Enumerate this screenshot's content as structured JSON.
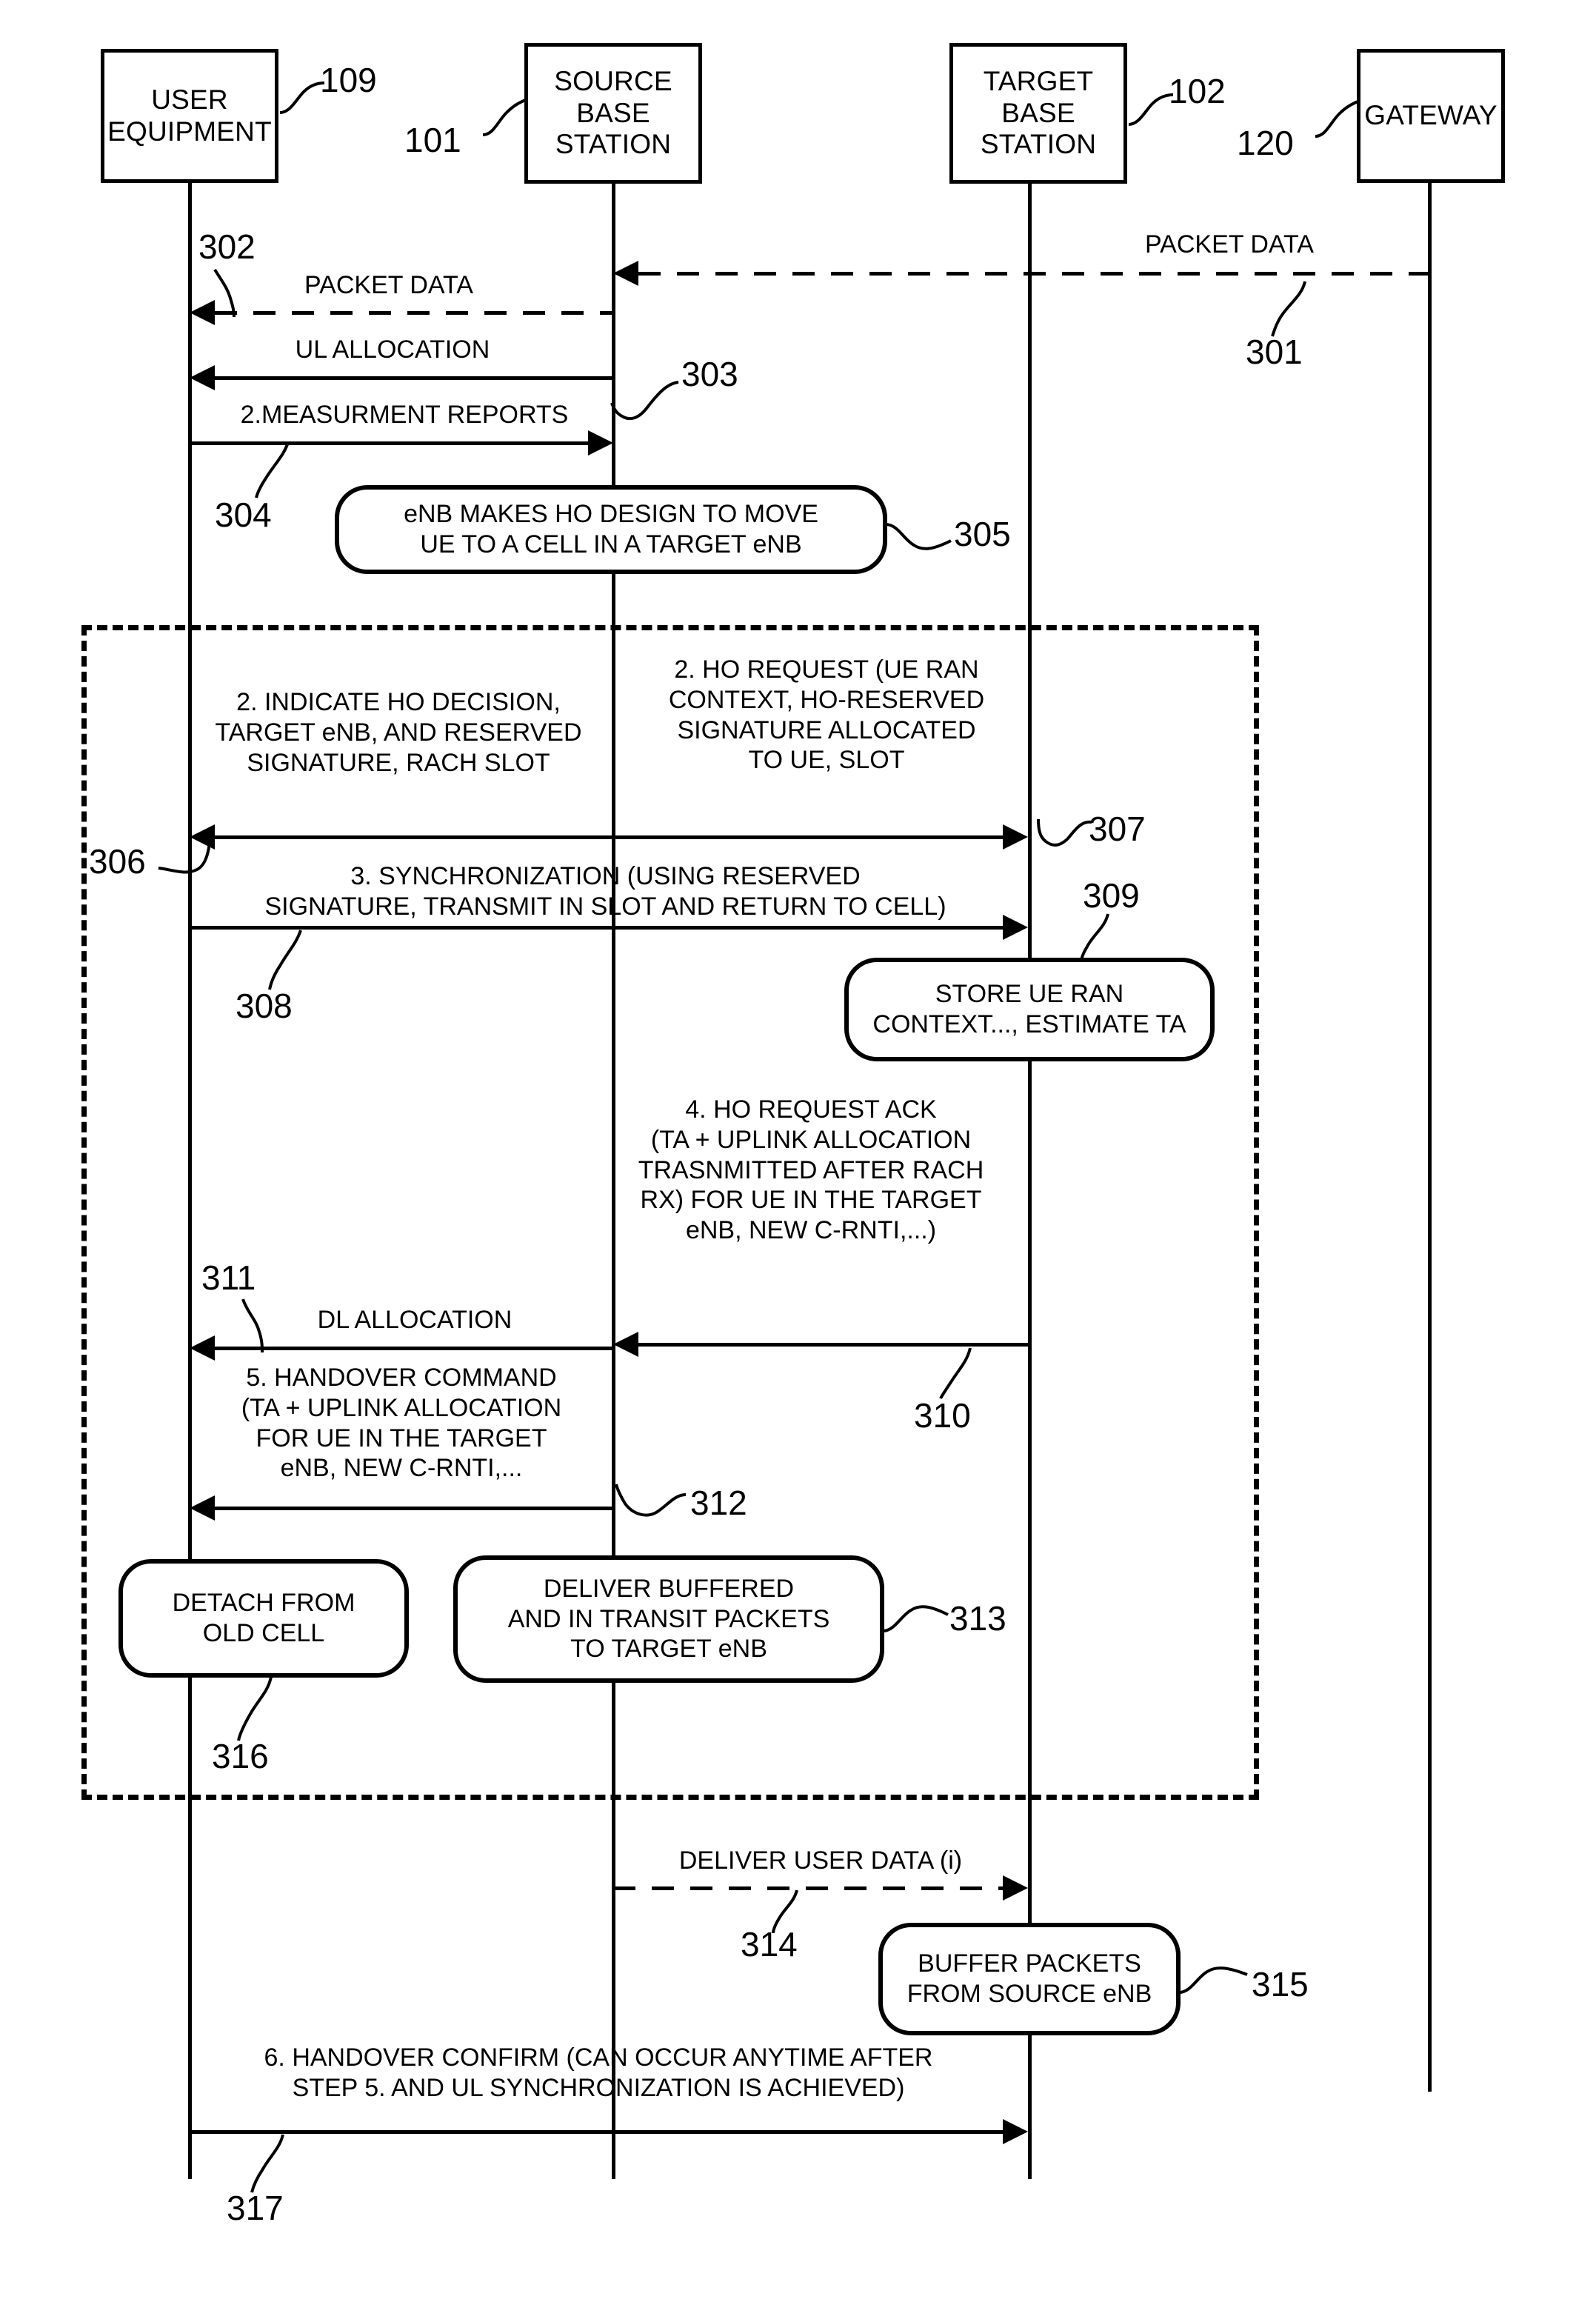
{
  "diagram": {
    "type": "sequence-diagram",
    "title": "LTE Handover Message Sequence",
    "actors": [
      {
        "id": "ue",
        "label": "USER\nEQUIPMENT",
        "numeral": "109"
      },
      {
        "id": "source_bs",
        "label": "SOURCE\nBASE\nSTATION",
        "numeral": "101"
      },
      {
        "id": "target_bs",
        "label": "TARGET\nBASE\nSTATION",
        "numeral": "102"
      },
      {
        "id": "gateway",
        "label": "GATEWAY",
        "numeral": "120"
      }
    ],
    "messages": [
      {
        "id": "301",
        "numeral": "301",
        "label": "PACKET DATA",
        "style": "dashed",
        "direction": "left",
        "from": "gateway",
        "to": "source_bs"
      },
      {
        "id": "302",
        "numeral": "302",
        "label": "PACKET DATA",
        "style": "dashed",
        "direction": "left",
        "from": "source_bs",
        "to": "ue"
      },
      {
        "id": "303",
        "numeral": "303",
        "label": "UL ALLOCATION",
        "style": "solid",
        "direction": "left",
        "from": "source_bs",
        "to": "ue"
      },
      {
        "id": "304",
        "numeral": "304",
        "label": "2.MEASURMENT REPORTS",
        "style": "solid",
        "direction": "right",
        "from": "ue",
        "to": "source_bs"
      },
      {
        "id": "306",
        "numeral": "306",
        "label": "2. INDICATE HO DECISION,\nTARGET eNB, AND RESERVED\nSIGNATURE, RACH SLOT",
        "style": "solid",
        "direction": "left",
        "from": "source_bs",
        "to": "ue"
      },
      {
        "id": "307",
        "numeral": "307",
        "label": "2. HO REQUEST (UE RAN\nCONTEXT, HO-RESERVED\nSIGNATURE ALLOCATED\nTO UE, SLOT",
        "style": "solid",
        "direction": "right",
        "from": "source_bs",
        "to": "target_bs"
      },
      {
        "id": "308",
        "numeral": "308",
        "label": "3. SYNCHRONIZATION (USING RESERVED\nSIGNATURE, TRANSMIT IN SLOT AND RETURN TO CELL)",
        "style": "solid",
        "direction": "right",
        "from": "ue",
        "to": "target_bs"
      },
      {
        "id": "310",
        "numeral": "310",
        "label": "4. HO REQUEST ACK\n(TA + UPLINK ALLOCATION\nTRASNMITTED AFTER RACH\nRX) FOR UE IN THE TARGET\neNB, NEW C-RNTI,...)",
        "style": "solid",
        "direction": "left",
        "from": "target_bs",
        "to": "source_bs"
      },
      {
        "id": "311",
        "numeral": "311",
        "label": "DL ALLOCATION",
        "style": "solid",
        "direction": "left",
        "from": "source_bs",
        "to": "ue"
      },
      {
        "id": "312",
        "numeral": "312",
        "label": "5. HANDOVER COMMAND\n(TA + UPLINK ALLOCATION\nFOR UE IN THE TARGET\neNB, NEW C-RNTI,...",
        "style": "solid",
        "direction": "left",
        "from": "source_bs",
        "to": "ue"
      },
      {
        "id": "314",
        "numeral": "314",
        "label": "DELIVER USER DATA (i)",
        "style": "dashed",
        "direction": "right",
        "from": "source_bs",
        "to": "target_bs"
      },
      {
        "id": "317",
        "numeral": "317",
        "label": "6. HANDOVER CONFIRM (CAN OCCUR ANYTIME AFTER\nSTEP 5. AND UL SYNCHRONIZATION  IS ACHIEVED)",
        "style": "solid",
        "direction": "right",
        "from": "ue",
        "to": "target_bs"
      }
    ],
    "process_boxes": [
      {
        "id": "305",
        "numeral": "305",
        "label": "eNB MAKES HO DESIGN TO MOVE\nUE TO A CELL IN A TARGET eNB",
        "on": "source_bs"
      },
      {
        "id": "309",
        "numeral": "309",
        "label": "STORE UE RAN\nCONTEXT..., ESTIMATE TA",
        "on": "target_bs"
      },
      {
        "id": "313",
        "numeral": "313",
        "label": "DELIVER BUFFERED\nAND IN TRANSIT PACKETS\nTO TARGET eNB",
        "on": "source_bs"
      },
      {
        "id": "315",
        "numeral": "315",
        "label": "BUFFER PACKETS\nFROM SOURCE eNB",
        "on": "target_bs"
      },
      {
        "id": "316",
        "numeral": "316",
        "label": "DETACH FROM\nOLD CELL",
        "on": "ue"
      }
    ],
    "colors": {
      "stroke": "#000000",
      "background": "#ffffff"
    }
  }
}
